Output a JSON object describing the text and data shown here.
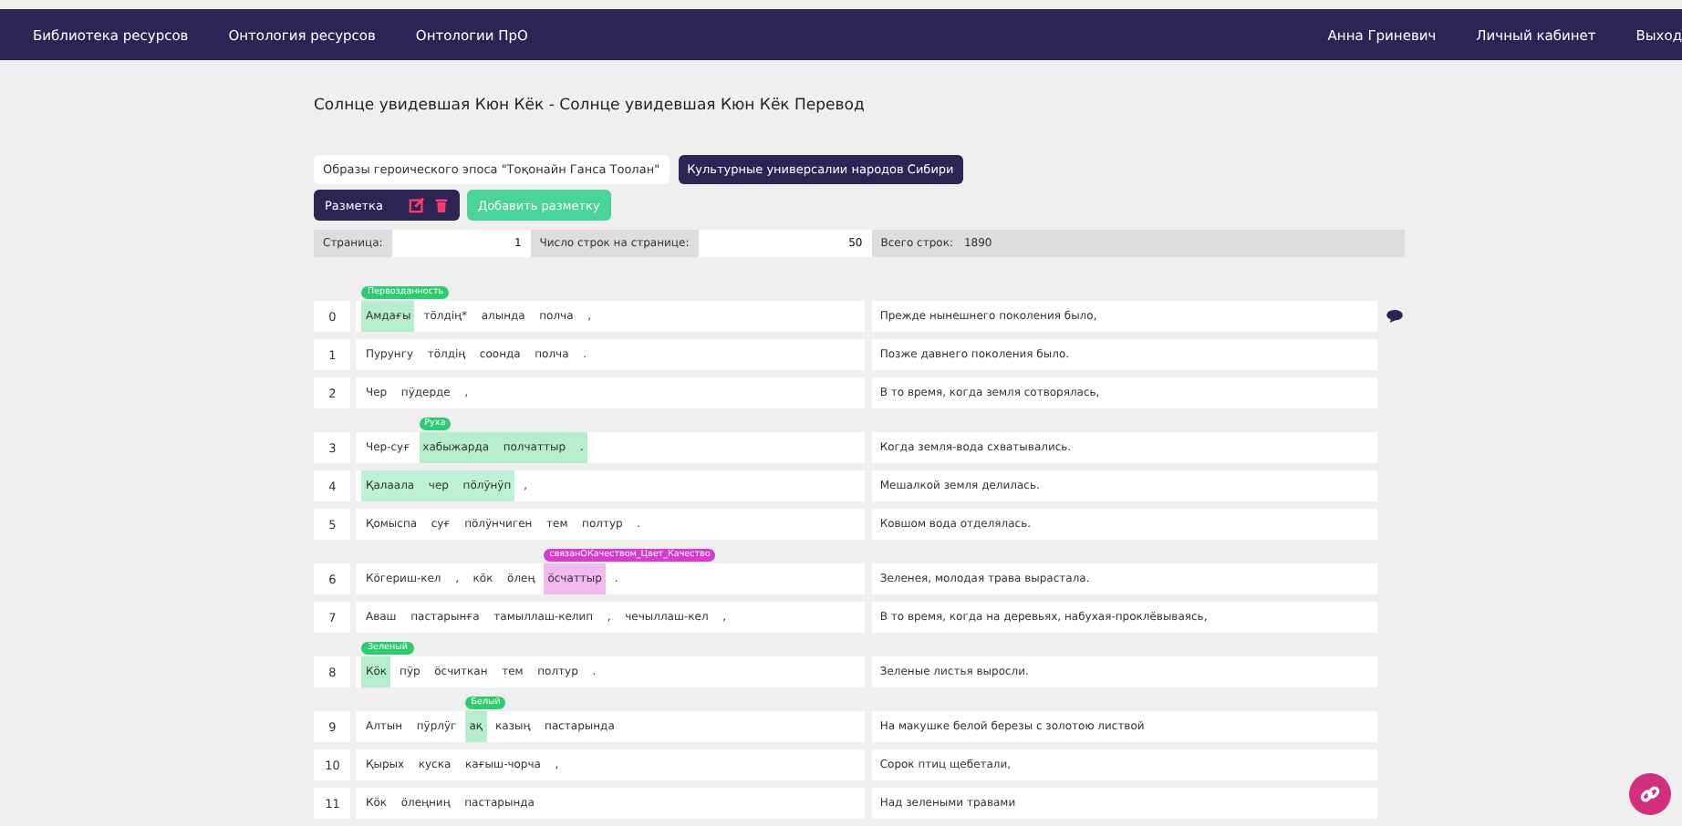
{
  "nav": {
    "left": [
      "Библиотека ресурсов",
      "Онтология ресурсов",
      "Онтологии ПрО"
    ],
    "right": [
      "Анна Гриневич",
      "Личный кабинет",
      "Выход"
    ]
  },
  "title": "Солнце увидевшая Кюн Кёк - Солнце увидевшая Кюн Кёк Перевод",
  "chips": [
    {
      "label": "Образы героического эпоса \"Тоқонайн Ганса Тоолан\"",
      "selected": false
    },
    {
      "label": "Культурные универсалии народов Сибири",
      "selected": true
    }
  ],
  "markup": {
    "label": "Разметка",
    "add_button": "Добавить разметку"
  },
  "pager": {
    "page_label": "Страница:",
    "page": "1",
    "rows_label": "Число строк на странице:",
    "rows": "50",
    "total_label": "Всего строк:",
    "total": "1890"
  },
  "rows": [
    {
      "number": "0",
      "segments": [
        {
          "text": "Амдағы",
          "highlighted": true,
          "color": "#2ecc71",
          "tag": "Первозданность"
        },
        {
          "text": "тöлдің*  алында  полча  ,",
          "highlighted": false
        }
      ],
      "translation": "Прежде нынешнего поколения было,",
      "comment": true
    },
    {
      "number": "1",
      "segments": [
        {
          "text": "Пурунгу  тöлдің  соонда  полча  .",
          "highlighted": false
        }
      ],
      "translation": "Позже давнего поколения было.",
      "comment": false
    },
    {
      "number": "2",
      "segments": [
        {
          "text": "Чер  пӱдерде  ,",
          "highlighted": false
        }
      ],
      "translation": "В то время, когда земля сотворялась,",
      "comment": false
    },
    {
      "number": "3",
      "segments": [
        {
          "text": "Чер-суғ",
          "highlighted": false
        },
        {
          "text": "хабыжарда  полчаттыр  .",
          "highlighted": true,
          "color": "#2ecc71",
          "tag": "Руха"
        }
      ],
      "translation": "Когда земля-вода схватывались.",
      "comment": false
    },
    {
      "number": "4",
      "segments": [
        {
          "text": "Қалаала  чер  пöлӱнӱп",
          "highlighted": true
        },
        {
          "text": ",",
          "highlighted": false
        }
      ],
      "translation": "Мешалкой земля делилась.",
      "comment": false
    },
    {
      "number": "5",
      "segments": [
        {
          "text": "Қомыспа  суғ  пöлӱнчиген  тем  полтур  .",
          "highlighted": false
        }
      ],
      "translation": "Ковшом вода отделялась.",
      "comment": false
    },
    {
      "number": "6",
      "segments": [
        {
          "text": "Кӧгериш-кел  ,  кӧк  öлең",
          "highlighted": false
        },
        {
          "text": "öсчаттыр",
          "highlighted": true,
          "color": "#d63bd0",
          "tag": "связанОКачеством_Цвет_Качество"
        },
        {
          "text": ".",
          "highlighted": false
        }
      ],
      "translation": "Зеленея, молодая трава вырастала.",
      "comment": false
    },
    {
      "number": "7",
      "segments": [
        {
          "text": "Аваш  пастарынға  тамыллаш-келип  ,  чечыллаш-кел  ,",
          "highlighted": false
        }
      ],
      "translation": "В то время, когда на деревьях, набухая-проклёвываясь,",
      "comment": false
    },
    {
      "number": "8",
      "segments": [
        {
          "text": "Кӧк",
          "highlighted": true,
          "color": "#2ecc71",
          "tag": "Зеленый"
        },
        {
          "text": "пӱр  öсчиткан  тем  полтур  .",
          "highlighted": false
        }
      ],
      "translation": "Зеленые листья выросли.",
      "comment": false
    },
    {
      "number": "9",
      "segments": [
        {
          "text": "Алтын  пӱрлӱг",
          "highlighted": false
        },
        {
          "text": "ақ",
          "highlighted": true,
          "color": "#2ecc71",
          "tag": "Белый"
        },
        {
          "text": "казың  пастарында",
          "highlighted": false
        }
      ],
      "translation": "На макушке белой березы с золотою листвой",
      "comment": false
    },
    {
      "number": "10",
      "segments": [
        {
          "text": "Қырых  куска  кағыш-чорча  ,",
          "highlighted": false
        }
      ],
      "translation": "Сорок птиц щебетали,",
      "comment": false
    },
    {
      "number": "11",
      "segments": [
        {
          "text": "Кӧк  öлеңниң  пастарында",
          "highlighted": false
        }
      ],
      "translation": "Над зелеными травами",
      "comment": false
    }
  ]
}
